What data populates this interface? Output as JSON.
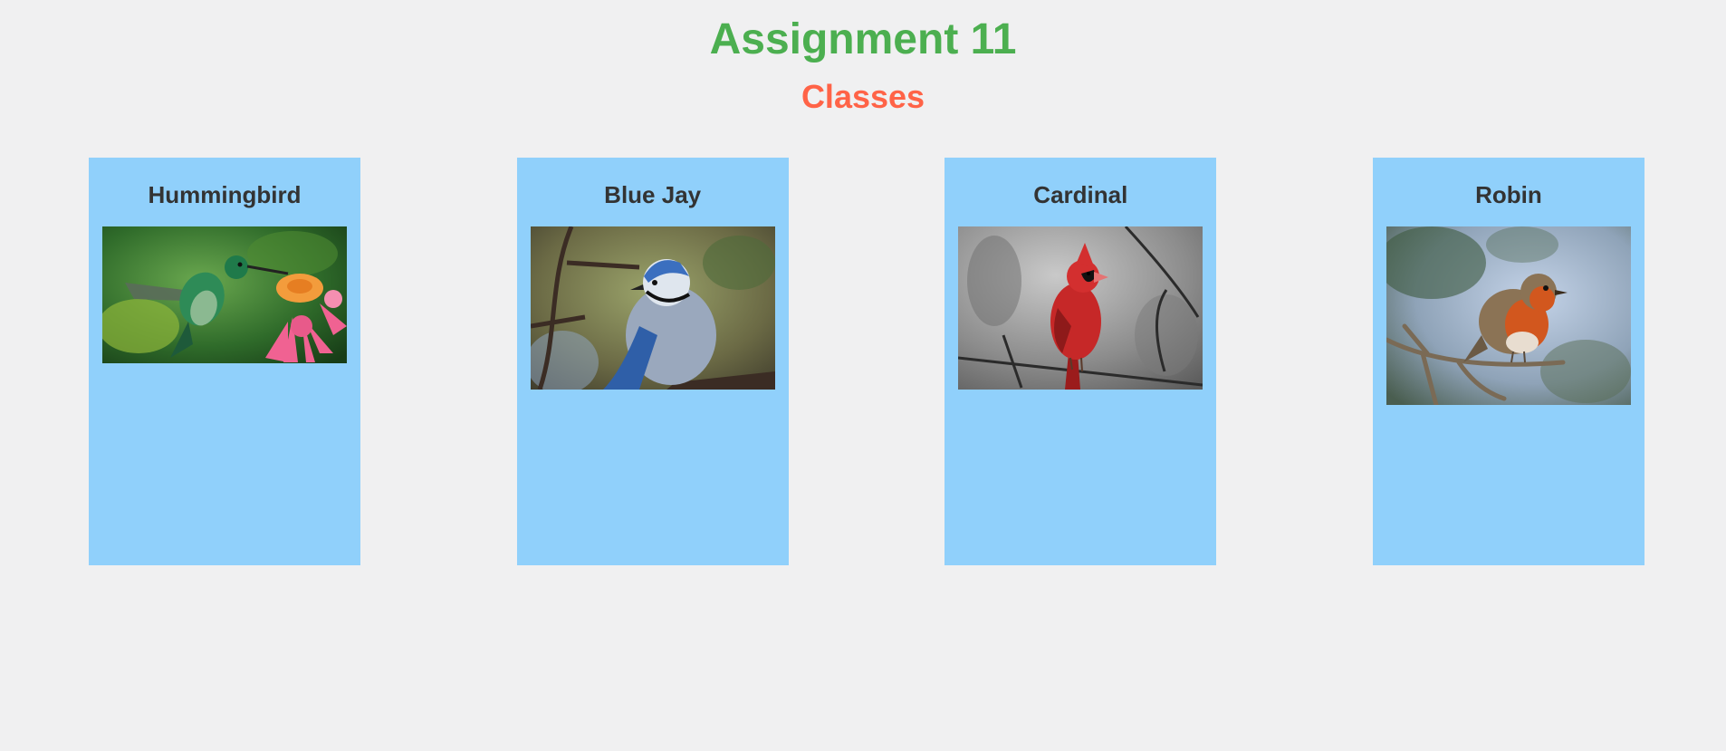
{
  "header": {
    "title": "Assignment 11",
    "subtitle": "Classes"
  },
  "cards": [
    {
      "name": "Hummingbird",
      "image_subject": "hummingbird-photo"
    },
    {
      "name": "Blue Jay",
      "image_subject": "blue-jay-photo"
    },
    {
      "name": "Cardinal",
      "image_subject": "cardinal-photo"
    },
    {
      "name": "Robin",
      "image_subject": "robin-photo"
    }
  ],
  "colors": {
    "background": "#f0f0f1",
    "title": "#4caf50",
    "subtitle": "#ff6347",
    "card": "#90d0fb",
    "card_text": "#333333"
  }
}
